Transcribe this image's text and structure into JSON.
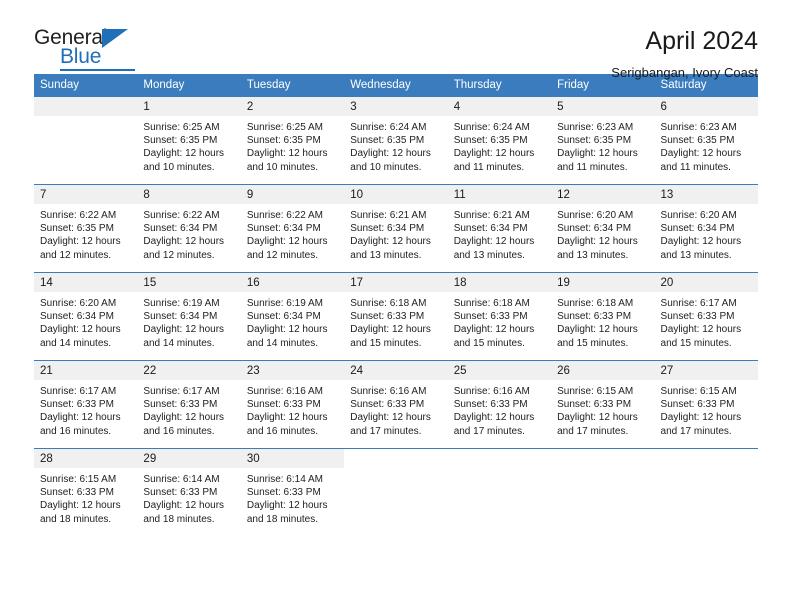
{
  "brand": {
    "name_top": "General",
    "name_bottom": "Blue",
    "accent_color": "#1f70b8",
    "triangle_icon": "triangle-icon"
  },
  "header": {
    "title": "April 2024",
    "subtitle": "Serigbangan, Ivory Coast"
  },
  "calendar": {
    "header_bg": "#3a7cbe",
    "daynum_bg": "#f0f0f0",
    "weekdays": [
      "Sunday",
      "Monday",
      "Tuesday",
      "Wednesday",
      "Thursday",
      "Friday",
      "Saturday"
    ],
    "weeks": [
      [
        {
          "day": "",
          "blank": true,
          "filled": true,
          "lines": []
        },
        {
          "day": "1",
          "lines": [
            "Sunrise: 6:25 AM",
            "Sunset: 6:35 PM",
            "Daylight: 12 hours",
            "and 10 minutes."
          ]
        },
        {
          "day": "2",
          "lines": [
            "Sunrise: 6:25 AM",
            "Sunset: 6:35 PM",
            "Daylight: 12 hours",
            "and 10 minutes."
          ]
        },
        {
          "day": "3",
          "lines": [
            "Sunrise: 6:24 AM",
            "Sunset: 6:35 PM",
            "Daylight: 12 hours",
            "and 10 minutes."
          ]
        },
        {
          "day": "4",
          "lines": [
            "Sunrise: 6:24 AM",
            "Sunset: 6:35 PM",
            "Daylight: 12 hours",
            "and 11 minutes."
          ]
        },
        {
          "day": "5",
          "lines": [
            "Sunrise: 6:23 AM",
            "Sunset: 6:35 PM",
            "Daylight: 12 hours",
            "and 11 minutes."
          ]
        },
        {
          "day": "6",
          "lines": [
            "Sunrise: 6:23 AM",
            "Sunset: 6:35 PM",
            "Daylight: 12 hours",
            "and 11 minutes."
          ]
        }
      ],
      [
        {
          "day": "7",
          "lines": [
            "Sunrise: 6:22 AM",
            "Sunset: 6:35 PM",
            "Daylight: 12 hours",
            "and 12 minutes."
          ]
        },
        {
          "day": "8",
          "lines": [
            "Sunrise: 6:22 AM",
            "Sunset: 6:34 PM",
            "Daylight: 12 hours",
            "and 12 minutes."
          ]
        },
        {
          "day": "9",
          "lines": [
            "Sunrise: 6:22 AM",
            "Sunset: 6:34 PM",
            "Daylight: 12 hours",
            "and 12 minutes."
          ]
        },
        {
          "day": "10",
          "lines": [
            "Sunrise: 6:21 AM",
            "Sunset: 6:34 PM",
            "Daylight: 12 hours",
            "and 13 minutes."
          ]
        },
        {
          "day": "11",
          "lines": [
            "Sunrise: 6:21 AM",
            "Sunset: 6:34 PM",
            "Daylight: 12 hours",
            "and 13 minutes."
          ]
        },
        {
          "day": "12",
          "lines": [
            "Sunrise: 6:20 AM",
            "Sunset: 6:34 PM",
            "Daylight: 12 hours",
            "and 13 minutes."
          ]
        },
        {
          "day": "13",
          "lines": [
            "Sunrise: 6:20 AM",
            "Sunset: 6:34 PM",
            "Daylight: 12 hours",
            "and 13 minutes."
          ]
        }
      ],
      [
        {
          "day": "14",
          "lines": [
            "Sunrise: 6:20 AM",
            "Sunset: 6:34 PM",
            "Daylight: 12 hours",
            "and 14 minutes."
          ]
        },
        {
          "day": "15",
          "lines": [
            "Sunrise: 6:19 AM",
            "Sunset: 6:34 PM",
            "Daylight: 12 hours",
            "and 14 minutes."
          ]
        },
        {
          "day": "16",
          "lines": [
            "Sunrise: 6:19 AM",
            "Sunset: 6:34 PM",
            "Daylight: 12 hours",
            "and 14 minutes."
          ]
        },
        {
          "day": "17",
          "lines": [
            "Sunrise: 6:18 AM",
            "Sunset: 6:33 PM",
            "Daylight: 12 hours",
            "and 15 minutes."
          ]
        },
        {
          "day": "18",
          "lines": [
            "Sunrise: 6:18 AM",
            "Sunset: 6:33 PM",
            "Daylight: 12 hours",
            "and 15 minutes."
          ]
        },
        {
          "day": "19",
          "lines": [
            "Sunrise: 6:18 AM",
            "Sunset: 6:33 PM",
            "Daylight: 12 hours",
            "and 15 minutes."
          ]
        },
        {
          "day": "20",
          "lines": [
            "Sunrise: 6:17 AM",
            "Sunset: 6:33 PM",
            "Daylight: 12 hours",
            "and 15 minutes."
          ]
        }
      ],
      [
        {
          "day": "21",
          "lines": [
            "Sunrise: 6:17 AM",
            "Sunset: 6:33 PM",
            "Daylight: 12 hours",
            "and 16 minutes."
          ]
        },
        {
          "day": "22",
          "lines": [
            "Sunrise: 6:17 AM",
            "Sunset: 6:33 PM",
            "Daylight: 12 hours",
            "and 16 minutes."
          ]
        },
        {
          "day": "23",
          "lines": [
            "Sunrise: 6:16 AM",
            "Sunset: 6:33 PM",
            "Daylight: 12 hours",
            "and 16 minutes."
          ]
        },
        {
          "day": "24",
          "lines": [
            "Sunrise: 6:16 AM",
            "Sunset: 6:33 PM",
            "Daylight: 12 hours",
            "and 17 minutes."
          ]
        },
        {
          "day": "25",
          "lines": [
            "Sunrise: 6:16 AM",
            "Sunset: 6:33 PM",
            "Daylight: 12 hours",
            "and 17 minutes."
          ]
        },
        {
          "day": "26",
          "lines": [
            "Sunrise: 6:15 AM",
            "Sunset: 6:33 PM",
            "Daylight: 12 hours",
            "and 17 minutes."
          ]
        },
        {
          "day": "27",
          "lines": [
            "Sunrise: 6:15 AM",
            "Sunset: 6:33 PM",
            "Daylight: 12 hours",
            "and 17 minutes."
          ]
        }
      ],
      [
        {
          "day": "28",
          "lines": [
            "Sunrise: 6:15 AM",
            "Sunset: 6:33 PM",
            "Daylight: 12 hours",
            "and 18 minutes."
          ]
        },
        {
          "day": "29",
          "lines": [
            "Sunrise: 6:14 AM",
            "Sunset: 6:33 PM",
            "Daylight: 12 hours",
            "and 18 minutes."
          ]
        },
        {
          "day": "30",
          "lines": [
            "Sunrise: 6:14 AM",
            "Sunset: 6:33 PM",
            "Daylight: 12 hours",
            "and 18 minutes."
          ]
        },
        {
          "day": "",
          "blank": true,
          "filled": false,
          "lines": []
        },
        {
          "day": "",
          "blank": true,
          "filled": false,
          "lines": []
        },
        {
          "day": "",
          "blank": true,
          "filled": false,
          "lines": []
        },
        {
          "day": "",
          "blank": true,
          "filled": false,
          "lines": []
        }
      ]
    ]
  }
}
